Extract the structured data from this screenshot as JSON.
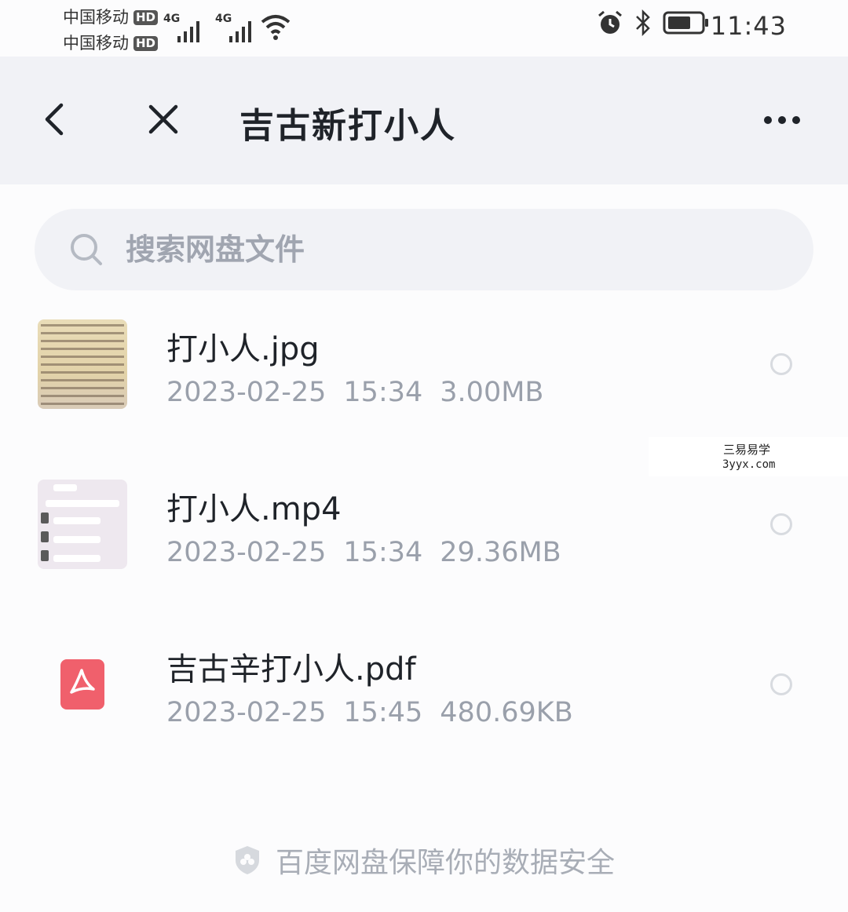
{
  "status_bar": {
    "carriers": [
      {
        "name": "中国移动",
        "badge": "HD"
      },
      {
        "name": "中国移动",
        "badge": "HD"
      }
    ],
    "signals": [
      "4G",
      "4G"
    ],
    "time": "11:43"
  },
  "navbar": {
    "title": "吉古新打小人"
  },
  "search": {
    "placeholder": "搜索网盘文件"
  },
  "files": [
    {
      "name": "打小人.jpg",
      "date": "2023-02-25",
      "time": "15:34",
      "size": "3.00MB",
      "type": "jpg"
    },
    {
      "name": "打小人.mp4",
      "date": "2023-02-25",
      "time": "15:34",
      "size": "29.36MB",
      "type": "mp4"
    },
    {
      "name": "吉古辛打小人.pdf",
      "date": "2023-02-25",
      "time": "15:45",
      "size": "480.69KB",
      "type": "pdf"
    }
  ],
  "watermark": {
    "line1": "三易易学",
    "line2": "3yyx.com"
  },
  "footer": {
    "text": "百度网盘保障你的数据安全"
  },
  "colors": {
    "background": "#fcfcfd",
    "navbar": "#f1f2f6",
    "title": "#1f2329",
    "muted": "#9aa0ab",
    "pdf_red": "#f0606c"
  }
}
